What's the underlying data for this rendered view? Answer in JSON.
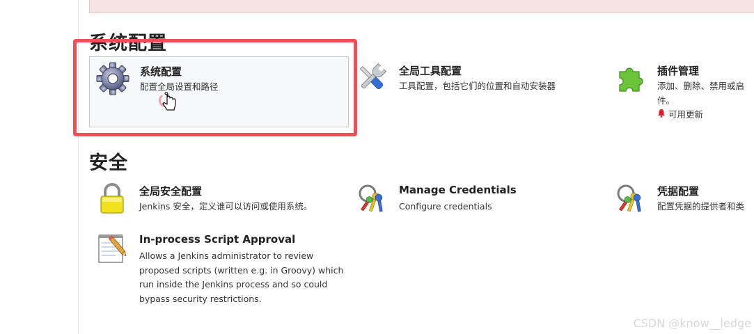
{
  "sections": {
    "system_config": {
      "title": "系统配置",
      "items": [
        {
          "title": "系统配置",
          "desc": "配置全局设置和路径"
        },
        {
          "title": "全局工具配置",
          "desc": "工具配置，包括它们的位置和自动安装器"
        },
        {
          "title": "插件管理",
          "desc_line1": "添加、删除、禁用或启",
          "desc_line2": "件。",
          "update_badge": "可用更新"
        }
      ]
    },
    "security": {
      "title": "安全",
      "items": [
        {
          "title": "全局安全配置",
          "desc": "Jenkins 安全，定义谁可以访问或使用系统。"
        },
        {
          "title": "Manage Credentials",
          "desc": "Configure credentials"
        },
        {
          "title": "凭据配置",
          "desc": "配置凭据的提供者和类"
        },
        {
          "title": "In-process Script Approval",
          "desc_lines": [
            "Allows a Jenkins administrator to review",
            "proposed scripts (written e.g. in Groovy) which",
            "run inside the Jenkins process and so could",
            "bypass security restrictions."
          ]
        }
      ]
    }
  },
  "watermark": "CSDN @know__ledge",
  "colors": {
    "highlight": "#ef5058",
    "alert_bg": "#f6e4e4"
  },
  "icons": {
    "system": "gear-icon",
    "tools": "wrench-screwdriver-icon",
    "plugins": "puzzle-piece-icon",
    "update": "bell-icon",
    "security": "padlock-icon",
    "credentials": "keys-icon",
    "credential_providers": "keys-icon",
    "script_approval": "notepad-pencil-icon",
    "cursor": "hand-pointer-icon"
  }
}
